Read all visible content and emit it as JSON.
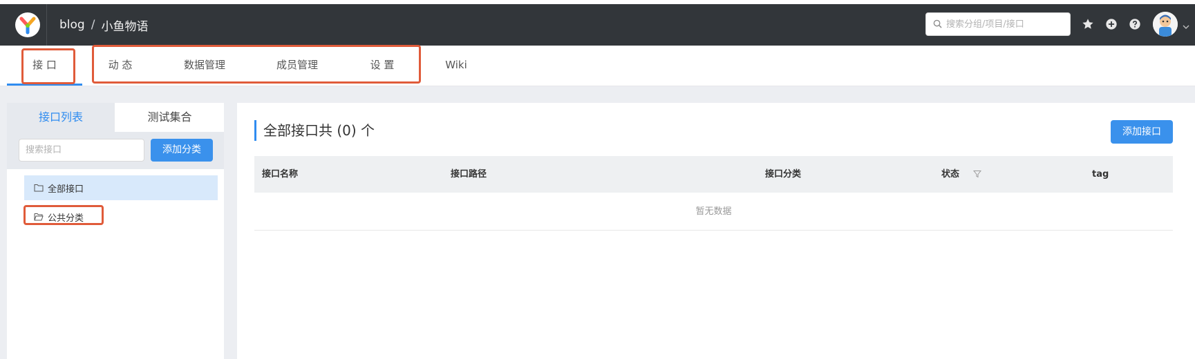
{
  "header": {
    "project_group": "blog",
    "separator": "/",
    "project_name": "小鱼物语",
    "search_placeholder": "搜索分组/项目/接口",
    "colors": {
      "background": "#32363a",
      "accent": "#2f8cf0"
    },
    "icons": [
      "yapi-logo-icon",
      "search-icon",
      "star-icon",
      "plus-circle-icon",
      "question-circle-icon",
      "avatar",
      "chevron-down-icon"
    ]
  },
  "subnav": {
    "tabs": [
      {
        "label": "接 口",
        "active": true
      },
      {
        "label": "动 态"
      },
      {
        "label": "数据管理"
      },
      {
        "label": "成员管理"
      },
      {
        "label": "设 置"
      },
      {
        "label": "Wiki"
      }
    ]
  },
  "sidebar": {
    "tabs": [
      {
        "label": "接口列表",
        "active": true
      },
      {
        "label": "测试集合"
      }
    ],
    "search_placeholder": "搜索接口",
    "add_category_label": "添加分类",
    "categories": [
      {
        "label": "全部接口",
        "selected": true,
        "icon": "folder-icon"
      },
      {
        "label": "公共分类",
        "icon": "folder-open-icon"
      }
    ]
  },
  "main": {
    "title": "全部接口共 (0) 个",
    "add_interface_label": "添加接口",
    "table": {
      "columns": [
        "接口名称",
        "接口路径",
        "接口分类",
        "状态",
        "tag"
      ],
      "empty_text": "暂无数据"
    }
  },
  "annotation_color": "#e05b3a"
}
